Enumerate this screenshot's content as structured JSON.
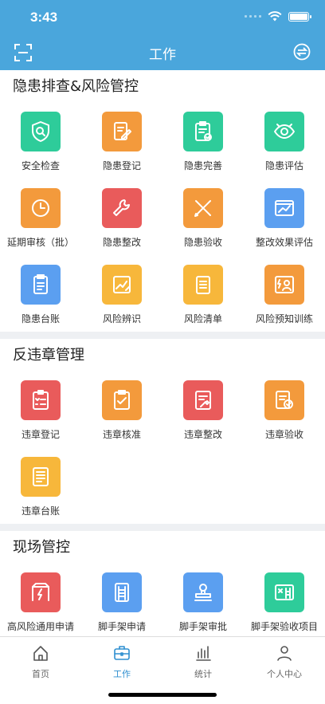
{
  "status_bar": {
    "time": "3:43"
  },
  "header": {
    "title": "工作",
    "scan_icon": "scan-icon",
    "switch_icon": "switch-icon"
  },
  "colors": {
    "primary": "#4aa6dc",
    "green": "#2ecc9a",
    "orange": "#f39a3c",
    "red": "#e95b5b",
    "blue": "#5b9ff0",
    "yellow": "#f7b73b"
  },
  "sections": [
    {
      "title": "隐患排查&风险管控",
      "items": [
        {
          "label": "安全检查",
          "icon": "shield-search-icon",
          "color": "#2ecc9a"
        },
        {
          "label": "隐患登记",
          "icon": "edit-document-icon",
          "color": "#f39a3c"
        },
        {
          "label": "隐患完善",
          "icon": "clipboard-check-icon",
          "color": "#2ecc9a"
        },
        {
          "label": "隐患评估",
          "icon": "eye-scan-icon",
          "color": "#2ecc9a"
        },
        {
          "label": "延期审核（批）",
          "icon": "clock-icon",
          "color": "#f39a3c"
        },
        {
          "label": "隐患整改",
          "icon": "wrench-icon",
          "color": "#e95b5b"
        },
        {
          "label": "隐患验收",
          "icon": "ruler-pencil-icon",
          "color": "#f39a3c"
        },
        {
          "label": "整改效果评估",
          "icon": "folder-chart-icon",
          "color": "#5b9ff0"
        },
        {
          "label": "隐患台账",
          "icon": "clipboard-list-icon",
          "color": "#5b9ff0"
        },
        {
          "label": "风险辨识",
          "icon": "chart-pencil-icon",
          "color": "#f7b73b"
        },
        {
          "label": "风险清单",
          "icon": "list-document-icon",
          "color": "#f7b73b"
        },
        {
          "label": "风险预知训练",
          "icon": "person-alert-icon",
          "color": "#f39a3c"
        }
      ]
    },
    {
      "title": "反违章管理",
      "items": [
        {
          "label": "违章登记",
          "icon": "checklist-icon",
          "color": "#e95b5b"
        },
        {
          "label": "违章核准",
          "icon": "clipboard-approve-icon",
          "color": "#f39a3c"
        },
        {
          "label": "违章整改",
          "icon": "document-wrench-icon",
          "color": "#e95b5b"
        },
        {
          "label": "违章验收",
          "icon": "document-badge-icon",
          "color": "#f39a3c"
        },
        {
          "label": "违章台账",
          "icon": "ledger-icon",
          "color": "#f7b73b"
        }
      ]
    },
    {
      "title": "现场管控",
      "items": [
        {
          "label": "高风险通用申请",
          "icon": "high-voltage-icon",
          "color": "#e95b5b"
        },
        {
          "label": "脚手架申请",
          "icon": "scaffold-document-icon",
          "color": "#5b9ff0"
        },
        {
          "label": "脚手架审批",
          "icon": "stamp-icon",
          "color": "#5b9ff0"
        },
        {
          "label": "脚手架验收项目",
          "icon": "scaffold-check-icon",
          "color": "#2ecc9a"
        }
      ]
    }
  ],
  "tabbar": {
    "tabs": [
      {
        "label": "首页",
        "icon": "home-icon",
        "active": false
      },
      {
        "label": "工作",
        "icon": "briefcase-icon",
        "active": true
      },
      {
        "label": "统计",
        "icon": "bar-chart-icon",
        "active": false
      },
      {
        "label": "个人中心",
        "icon": "person-icon",
        "active": false
      }
    ]
  }
}
